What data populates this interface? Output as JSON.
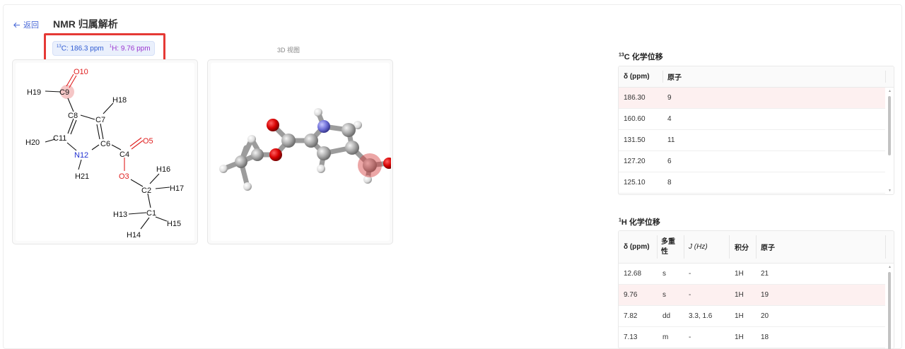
{
  "header": {
    "back_label": "返回",
    "title": "NMR 归属解析"
  },
  "badge": {
    "c_label": "C: 186.3 ppm",
    "h_label": "H: 9.76 ppm",
    "c_sup": "13",
    "h_sup": "1"
  },
  "view3d_label": "3D 视图",
  "molecule": {
    "atoms": [
      "O10",
      "H19",
      "C9",
      "H18",
      "C8",
      "C7",
      "H20",
      "C11",
      "C6",
      "O5",
      "N12",
      "C4",
      "H16",
      "H21",
      "O3",
      "C2",
      "H17",
      "H13",
      "C1",
      "H15",
      "H14"
    ],
    "highlighted_atom": "C9"
  },
  "c13": {
    "title_sup": "13",
    "title": "C 化学位移",
    "headers": [
      "δ (ppm)",
      "原子"
    ],
    "rows": [
      {
        "shift": "186.30",
        "atom": "9",
        "highlight": true
      },
      {
        "shift": "160.60",
        "atom": "4",
        "highlight": false
      },
      {
        "shift": "131.50",
        "atom": "11",
        "highlight": false
      },
      {
        "shift": "127.20",
        "atom": "6",
        "highlight": false
      },
      {
        "shift": "125.10",
        "atom": "8",
        "highlight": false
      }
    ]
  },
  "h1": {
    "title_sup": "1",
    "title": "H 化学位移",
    "headers": [
      "δ (ppm)",
      "多重性",
      "J (Hz)",
      "积分",
      "原子"
    ],
    "header_multiplicity_line1": "多重",
    "header_multiplicity_line2": "性",
    "rows": [
      {
        "shift": "12.68",
        "mult": "s",
        "j": "-",
        "integral": "1H",
        "atom": "21",
        "highlight": false
      },
      {
        "shift": "9.76",
        "mult": "s",
        "j": "-",
        "integral": "1H",
        "atom": "19",
        "highlight": true
      },
      {
        "shift": "7.82",
        "mult": "dd",
        "j": "3.3, 1.6",
        "integral": "1H",
        "atom": "20",
        "highlight": false
      },
      {
        "shift": "7.13",
        "mult": "m",
        "j": "-",
        "integral": "1H",
        "atom": "18",
        "highlight": false
      }
    ]
  },
  "colors": {
    "accent": "#4a6ad8",
    "highlight_row": "#fdf0f0",
    "highlight_border": "#e53935",
    "oxygen": "#e02020",
    "nitrogen": "#2030d0"
  }
}
